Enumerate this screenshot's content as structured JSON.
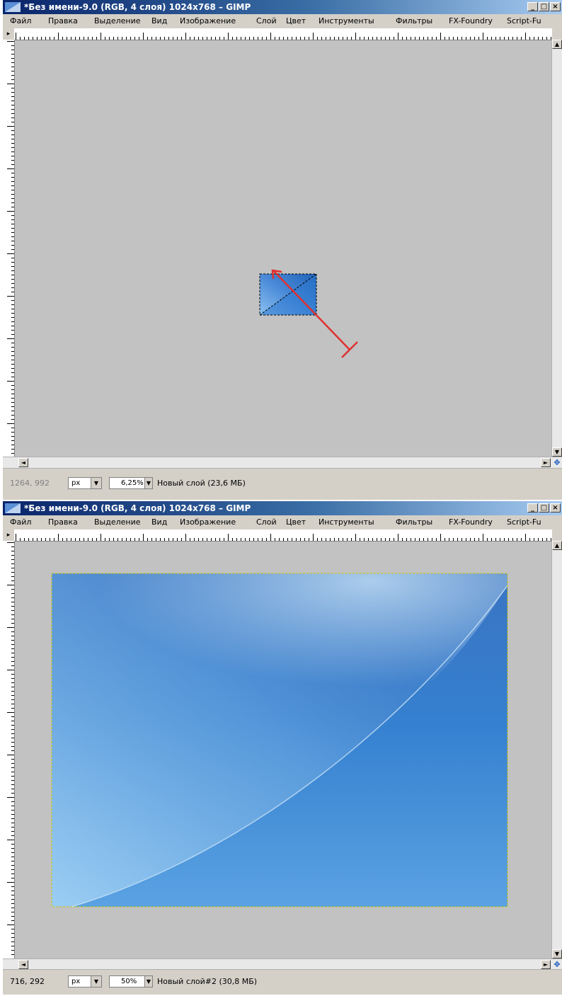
{
  "windows": [
    {
      "title": "*Без имени-9.0 (RGB, 4 слоя) 1024x768 – GIMP",
      "menu": [
        "Файл",
        "Правка",
        "Выделение",
        "Вид",
        "Изображение",
        "Слой",
        "Цвет",
        "Инструменты",
        "Фильтры",
        "FX-Foundry",
        "Script-Fu"
      ],
      "window_buttons": [
        "_",
        "□",
        "×"
      ],
      "status": {
        "coords": "1264, 992",
        "unit": "px",
        "zoom": "6,25%",
        "layer": "Новый слой (23,6 МБ)"
      }
    },
    {
      "title": "*Без имени-9.0 (RGB, 4 слоя) 1024x768 – GIMP",
      "menu": [
        "Файл",
        "Правка",
        "Выделение",
        "Вид",
        "Изображение",
        "Слой",
        "Цвет",
        "Инструменты",
        "Фильтры",
        "FX-Foundry",
        "Script-Fu"
      ],
      "window_buttons": [
        "_",
        "□",
        "×"
      ],
      "status": {
        "coords": "716, 292",
        "unit": "px",
        "zoom": "50%",
        "layer": "Новый слой#2 (30,8 МБ)"
      }
    }
  ],
  "icons": {
    "app": "gimp-window-icon",
    "arrow": "gradient-direction-arrow",
    "navigate": "navigate-icon"
  },
  "colors": {
    "title_start": "#0a246a",
    "title_end": "#a6caf0",
    "canvas_bg": "#c2c2c2",
    "gradient_blue": "#2e7ad0",
    "arrow_red": "#e03030"
  }
}
